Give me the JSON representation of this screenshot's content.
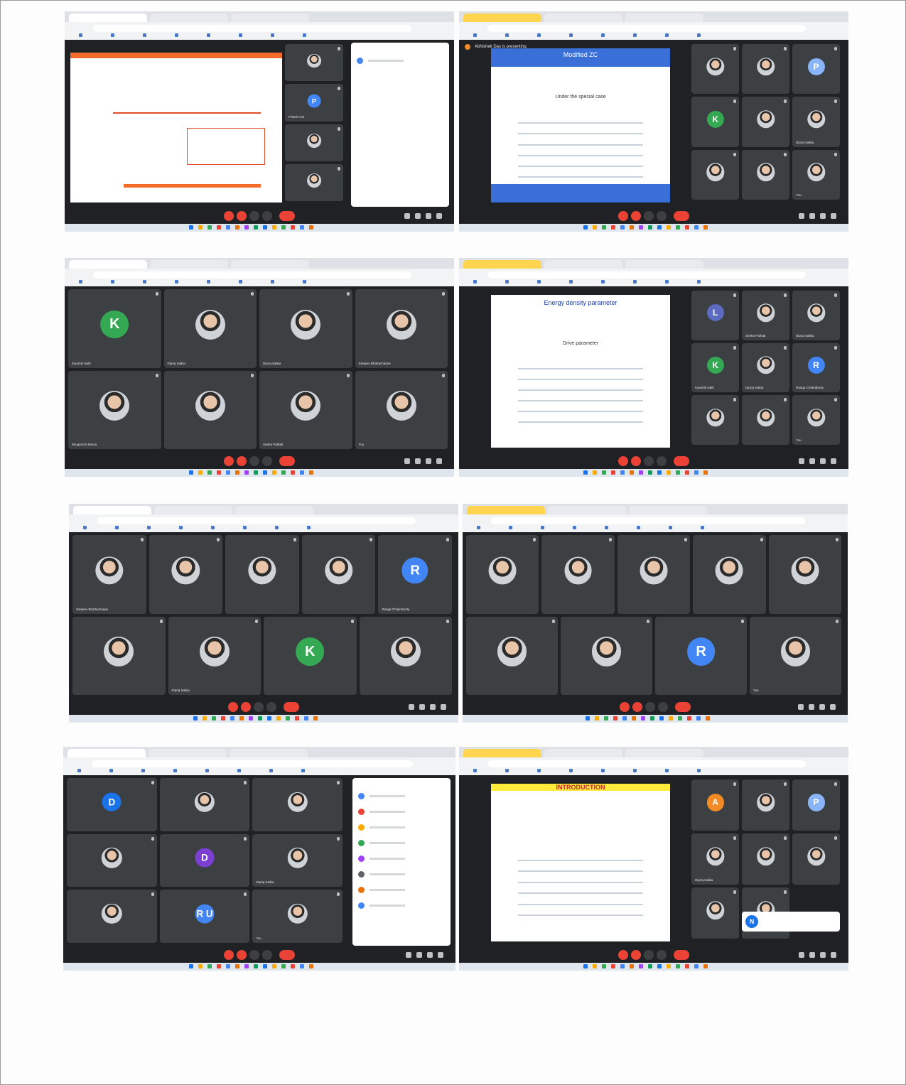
{
  "screenshots": [
    {
      "tabs": [
        "",
        "",
        ""
      ],
      "banner": "",
      "time": "",
      "tiles": [
        {
          "name": "",
          "avatar": "",
          "color": "#4285f4"
        },
        {
          "name": "Pritesh Giri",
          "avatar": "P",
          "color": "#4285f4"
        },
        {
          "name": "",
          "avatar": "",
          "color": "#4285f4"
        },
        {
          "name": "",
          "avatar": "",
          "color": "#4285f4"
        }
      ]
    },
    {
      "banner": "Abhishek Das is presenting",
      "time": "",
      "slide_title": "Modified ZC",
      "slide_subtitle": "Under the special case",
      "tiles": [
        {
          "name": "",
          "avatar": ""
        },
        {
          "name": "",
          "avatar": ""
        },
        {
          "name": "",
          "avatar": "P",
          "color": "#8ab4f8"
        },
        {
          "name": "",
          "avatar": "K",
          "color": "#34a853"
        },
        {
          "name": "",
          "avatar": ""
        },
        {
          "name": "Dipraj Saikia",
          "avatar": ""
        },
        {
          "name": "",
          "avatar": ""
        },
        {
          "name": "",
          "avatar": ""
        },
        {
          "name": "You",
          "avatar": ""
        }
      ]
    },
    {
      "time": "",
      "tiles": [
        {
          "name": "Kaushik Nath",
          "avatar": "K",
          "color": "#34a853"
        },
        {
          "name": "Dipraj Saikia",
          "avatar": ""
        },
        {
          "name": "Dipraj Saikia",
          "avatar": ""
        },
        {
          "name": "Sanjeev Bhattacharjee",
          "avatar": ""
        },
        {
          "name": "Mrugendra Barua",
          "avatar": ""
        },
        {
          "name": "",
          "avatar": ""
        },
        {
          "name": "Sneha Pathak",
          "avatar": ""
        },
        {
          "name": "You",
          "avatar": ""
        }
      ]
    },
    {
      "time": "",
      "slide_title": "Energy density parameter",
      "slide_subtitle": "Drive parameter",
      "tiles": [
        {
          "name": "",
          "avatar": "L",
          "color": "#5c6bc0"
        },
        {
          "name": "Sneha Pathak",
          "avatar": ""
        },
        {
          "name": "Dipraj Saikia",
          "avatar": ""
        },
        {
          "name": "Kaushik Nath",
          "avatar": "K",
          "color": "#34a853"
        },
        {
          "name": "Dipraj Saikia",
          "avatar": ""
        },
        {
          "name": "Ranga Chakraborty",
          "avatar": "R",
          "color": "#4285f4"
        },
        {
          "name": "",
          "avatar": ""
        },
        {
          "name": "",
          "avatar": ""
        },
        {
          "name": "You",
          "avatar": ""
        }
      ]
    },
    {
      "time": "",
      "tiles": [
        {
          "name": "Sanjeev Bhattacharjee",
          "avatar": ""
        },
        {
          "name": "",
          "avatar": ""
        },
        {
          "name": "",
          "avatar": ""
        },
        {
          "name": "",
          "avatar": ""
        },
        {
          "name": "Ranga Chakraborty",
          "avatar": "R",
          "color": "#4285f4"
        },
        {
          "name": "",
          "avatar": ""
        },
        {
          "name": "Dipraj Saikia",
          "avatar": ""
        },
        {
          "name": "",
          "avatar": "K",
          "color": "#34a853"
        },
        {
          "name": "",
          "avatar": ""
        }
      ]
    },
    {
      "time": "",
      "tiles": [
        {
          "name": "",
          "avatar": ""
        },
        {
          "name": "",
          "avatar": ""
        },
        {
          "name": "",
          "avatar": ""
        },
        {
          "name": "",
          "avatar": ""
        },
        {
          "name": "",
          "avatar": ""
        },
        {
          "name": "",
          "avatar": ""
        },
        {
          "name": "",
          "avatar": ""
        },
        {
          "name": "",
          "avatar": "R",
          "color": "#4285f4"
        },
        {
          "name": "You",
          "avatar": ""
        }
      ]
    },
    {
      "time": "",
      "tiles": [
        {
          "name": "",
          "avatar": "D",
          "color": "#1a73e8"
        },
        {
          "name": "",
          "avatar": ""
        },
        {
          "name": "",
          "avatar": ""
        },
        {
          "name": "",
          "avatar": ""
        },
        {
          "name": "",
          "avatar": "D",
          "color": "#7b3fd1"
        },
        {
          "name": "Dipraj Saikia",
          "avatar": ""
        },
        {
          "name": "",
          "avatar": ""
        },
        {
          "name": "",
          "avatar": "R U",
          "color": "#4285f4"
        },
        {
          "name": "You",
          "avatar": ""
        }
      ]
    },
    {
      "time": "",
      "slide_title": "INTRODUCTION",
      "tiles": [
        {
          "name": "",
          "avatar": "A",
          "color": "#f28b26"
        },
        {
          "name": "",
          "avatar": ""
        },
        {
          "name": "",
          "avatar": "P",
          "color": "#8ab4f8"
        },
        {
          "name": "Dipraj Saikia",
          "avatar": ""
        },
        {
          "name": "",
          "avatar": ""
        },
        {
          "name": "",
          "avatar": ""
        },
        {
          "name": "",
          "avatar": ""
        },
        {
          "name": "",
          "avatar": ""
        }
      ],
      "toast_avatar": "N"
    }
  ]
}
